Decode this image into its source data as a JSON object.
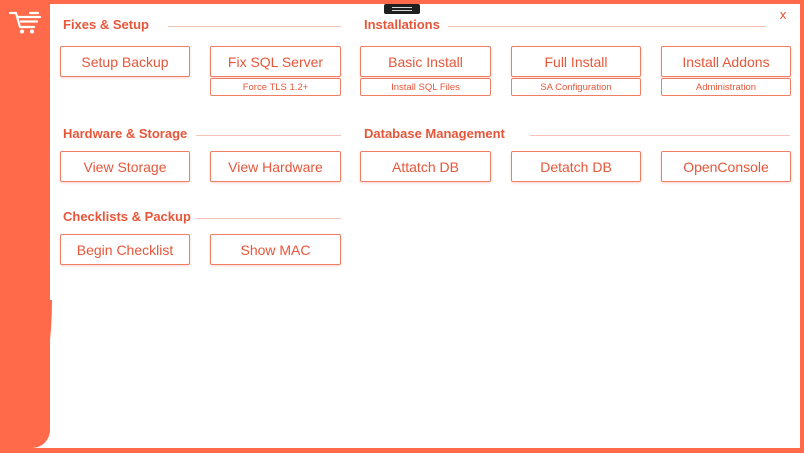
{
  "window": {
    "close_label": "x"
  },
  "colors": {
    "accent": "#e8563a",
    "frame": "#ff6b4a",
    "panel": "#ffffff"
  },
  "icons": {
    "logo": "cart-icon",
    "grip": "drag-handle-icon"
  },
  "sections": {
    "fixes": {
      "title": "Fixes & Setup",
      "setup_backup": "Setup Backup",
      "fix_sql": "Fix SQL Server",
      "force_tls": "Force TLS 1.2+"
    },
    "installations": {
      "title": "Installations",
      "basic_install": "Basic Install",
      "install_sql_files": "Install SQL Files",
      "full_install": "Full Install",
      "sa_config": "SA Configuration",
      "install_addons": "Install Addons",
      "administration": "Administration"
    },
    "hardware": {
      "title": "Hardware & Storage",
      "view_storage": "View Storage",
      "view_hardware": "View Hardware"
    },
    "database": {
      "title": "Database Management",
      "attach_db": "Attatch DB",
      "detach_db": "Detatch DB",
      "open_console": "OpenConsole"
    },
    "checklists": {
      "title": "Checklists & Packup",
      "begin_checklist": "Begin Checklist",
      "show_mac": "Show MAC"
    }
  }
}
